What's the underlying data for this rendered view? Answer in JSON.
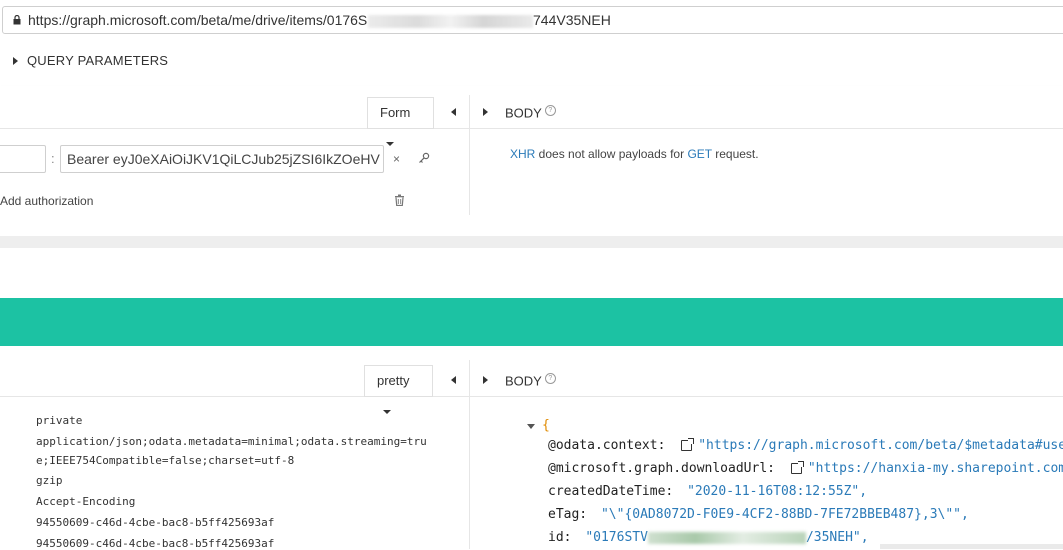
{
  "url_bar": {
    "url_prefix": "https://graph.microsoft.com/beta/me/drive/items/0176S",
    "url_suffix": "744V35NEH"
  },
  "query_params": {
    "label": "QUERY PARAMETERS"
  },
  "request": {
    "headers_mode": "Form",
    "body_label": "BODY",
    "help_glyph": "?",
    "auth_value": "Bearer eyJ0eXAiOiJKV1QiLCJub25jZSI6IkZOeHV",
    "colon": ":",
    "clear_glyph": "×",
    "add_authorization": "Add authorization",
    "note": {
      "part1": "XHR",
      "part2": " does not allow payloads for ",
      "part3": "GET",
      "part4": " request."
    }
  },
  "response": {
    "headers_mode": "pretty",
    "body_label": "BODY",
    "header_values": [
      "private",
      "application/json;odata.metadata=minimal;odata.streaming=tru",
      "e;IEEE754Compatible=false;charset=utf-8",
      "gzip",
      "Accept-Encoding",
      "94550609-c46d-4cbe-bac8-b5ff425693af",
      "94550609-c46d-4cbe-bac8-b5ff425693af"
    ],
    "json": {
      "open_brace": "{",
      "lines": [
        {
          "key": "@odata.context:",
          "value": "\"https://graph.microsoft.com/beta/$metadata#user",
          "link": true
        },
        {
          "key": "@microsoft.graph.downloadUrl:",
          "value": "\"https://hanxia-my.sharepoint.com/",
          "link": true
        },
        {
          "key": "createdDateTime:",
          "value": "\"2020-11-16T08:12:55Z\",",
          "link": false
        },
        {
          "key": "eTag:",
          "value": "\"\\\"{0AD8072D-F0E9-4CF2-88BD-7FE72BBEB487},3\\\"\",",
          "link": false
        },
        {
          "key": "id:",
          "value_prefix": "\"0176STV",
          "value_suffix": "/35NEH\",",
          "link": false
        }
      ]
    }
  },
  "colors": {
    "accent_teal": "#1cc2a3",
    "link_blue": "#2a7ab8",
    "brace_orange": "#e08a00"
  }
}
